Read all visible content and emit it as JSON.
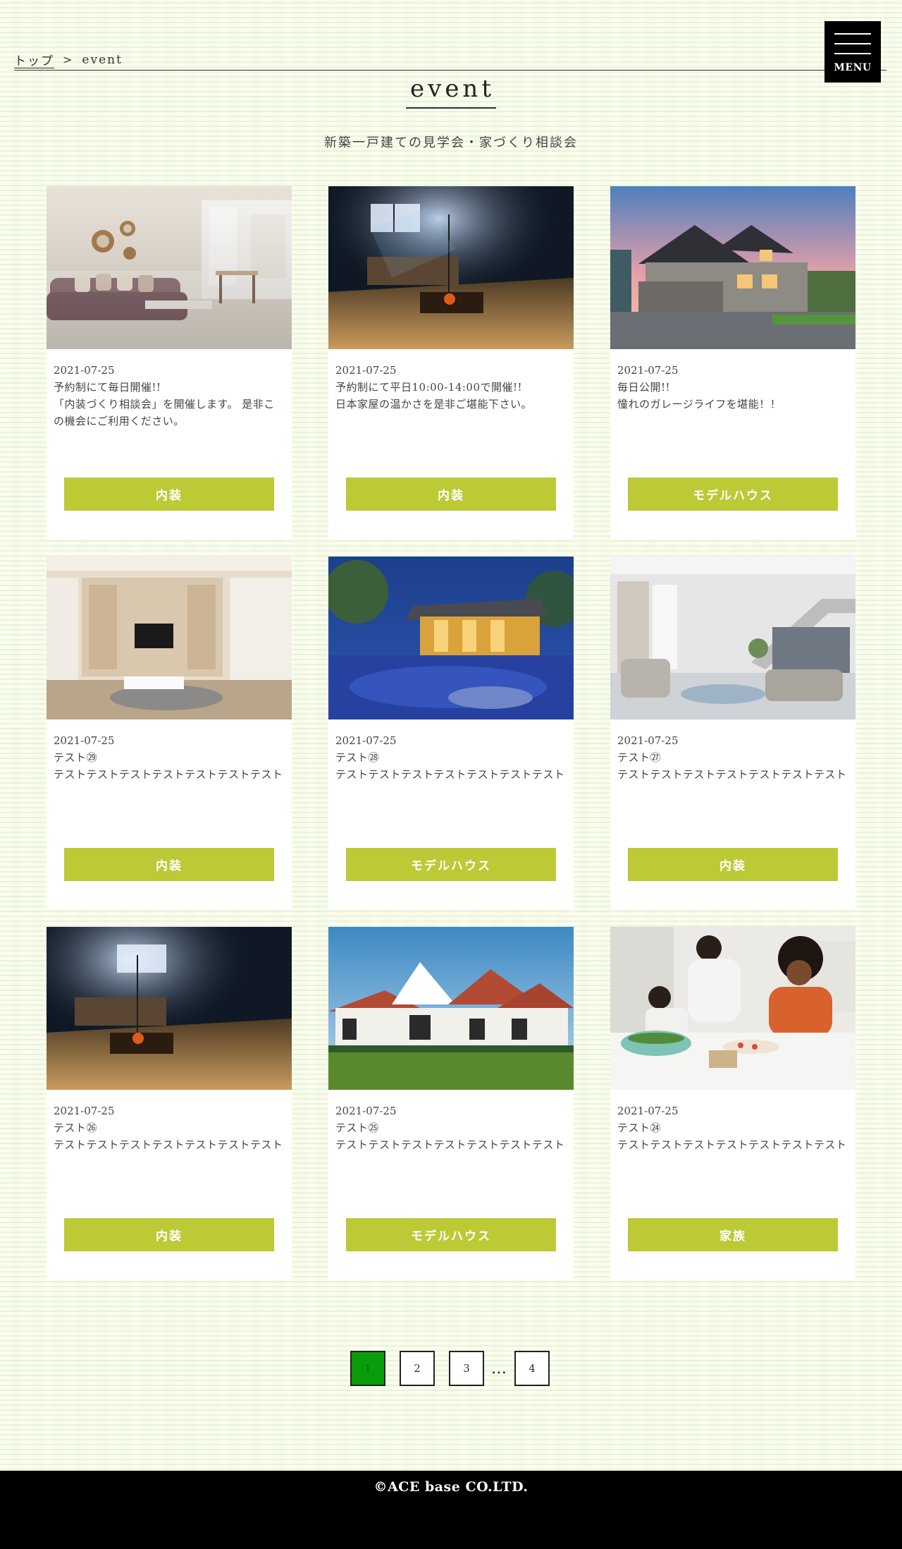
{
  "breadcrumb": {
    "home": "トップ",
    "separator": ">",
    "current": "event"
  },
  "menu": {
    "label": "MENU"
  },
  "page": {
    "title": "event",
    "subtitle": "新築一戸建ての見学会・家づくり相談会"
  },
  "cards": [
    {
      "date": "2021-07-25",
      "lines": [
        "予約制にて毎日開催!!",
        "「内装づくり相談会」を開催します。 是非この機会にご利用ください。"
      ],
      "tag": "内装",
      "image": "living-room-photo"
    },
    {
      "date": "2021-07-25",
      "lines": [
        "予約制にて平日10:00-14:00で開催!!",
        "日本家屋の温かさを是非ご堪能下さい。"
      ],
      "tag": "内装",
      "image": "japanese-house-interior-photo"
    },
    {
      "date": "2021-07-25",
      "lines": [
        "毎日公開!!",
        "憧れのガレージライフを堪能！！"
      ],
      "tag": "モデルハウス",
      "image": "house-with-garage-photo"
    },
    {
      "date": "2021-07-25",
      "lines": [
        "テスト㉙",
        "テストテストテストテストテストテストテスト"
      ],
      "tag": "内装",
      "image": "tv-living-room-photo"
    },
    {
      "date": "2021-07-25",
      "lines": [
        "テスト㉘",
        "テストテストテストテストテストテストテスト"
      ],
      "tag": "モデルハウス",
      "image": "night-modern-house-photo"
    },
    {
      "date": "2021-07-25",
      "lines": [
        "テスト㉗",
        "テストテストテストテストテストテストテスト"
      ],
      "tag": "内装",
      "image": "staircase-living-room-photo"
    },
    {
      "date": "2021-07-25",
      "lines": [
        "テスト㉖",
        "テストテストテストテストテストテストテスト"
      ],
      "tag": "内装",
      "image": "japanese-house-interior-photo"
    },
    {
      "date": "2021-07-25",
      "lines": [
        "テスト㉕",
        "テストテストテストテストテストテストテスト"
      ],
      "tag": "モデルハウス",
      "image": "tudor-house-photo"
    },
    {
      "date": "2021-07-25",
      "lines": [
        "テスト㉔",
        "テストテストテストテストテストテストテスト"
      ],
      "tag": "家族",
      "image": "family-kitchen-photo"
    }
  ],
  "pagination": {
    "pages": [
      "1",
      "2",
      "3",
      "4"
    ],
    "current": "1",
    "ellipsis": "…"
  },
  "footer": {
    "copyright": "©ACE base CO.LTD."
  },
  "colors": {
    "accent_green": "#bdc935",
    "current_page": "#0a9d0a",
    "footer_bg": "#000000"
  }
}
